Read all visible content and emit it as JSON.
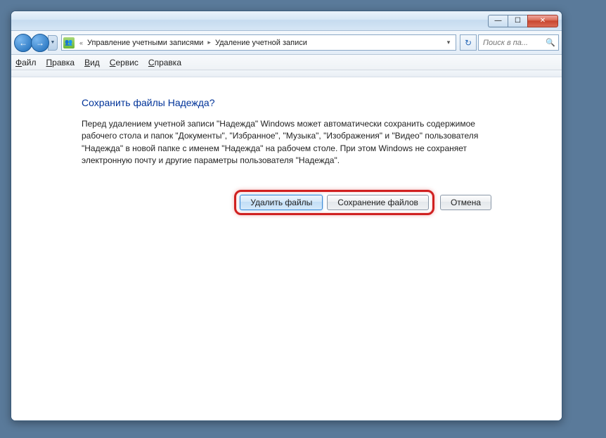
{
  "titlebar": {
    "minimize": "—",
    "maximize": "☐",
    "close": "✕"
  },
  "nav": {
    "back": "←",
    "forward": "→",
    "dropdown": "▼"
  },
  "address": {
    "prefix": "«",
    "seg1": "Управление учетными записями",
    "seg2": "Удаление учетной записи",
    "dropdown": "▾",
    "refresh": "↻"
  },
  "search": {
    "placeholder": "Поиск в па...",
    "icon": "🔍"
  },
  "menu": {
    "file_u": "Ф",
    "file_r": "айл",
    "edit_u": "П",
    "edit_r": "равка",
    "view_u": "В",
    "view_r": "ид",
    "tools_u": "С",
    "tools_r": "ервис",
    "help_u": "С",
    "help_r": "правка"
  },
  "content": {
    "heading": "Сохранить файлы Надежда?",
    "body": "Перед удалением учетной записи \"Надежда\" Windows может автоматически сохранить содержимое рабочего стола и папок \"Документы\", \"Избранное\", \"Музыка\", \"Изображения\" и \"Видео\" пользователя \"Надежда\" в новой папке с именем \"Надежда\" на рабочем столе. При этом Windows не сохраняет электронную почту и другие параметры пользователя \"Надежда\"."
  },
  "buttons": {
    "delete": "Удалить файлы",
    "save": "Сохранение файлов",
    "cancel": "Отмена"
  }
}
